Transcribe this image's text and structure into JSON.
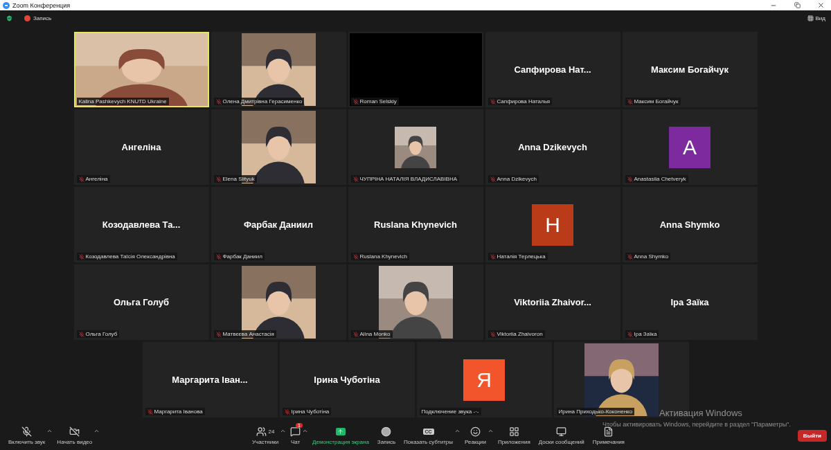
{
  "window": {
    "title": "Zoom Конференция"
  },
  "topbar": {
    "recording": "Запись",
    "view": "Вид"
  },
  "rows": [
    [
      {
        "kind": "camera",
        "label": "Kalina Pashkevych KNUTD Ukraine",
        "muted": false,
        "speaking": true
      },
      {
        "kind": "portrait",
        "label": "Олена Дмитрівна Герасименко",
        "muted": true,
        "speaking": false
      },
      {
        "kind": "blank",
        "label": "Roman Selskiy",
        "muted": true,
        "speaking": false
      },
      {
        "kind": "name",
        "name": "Сапфирова  Нат...",
        "label": "Сапфирова Наталья",
        "muted": true,
        "speaking": false
      },
      {
        "kind": "name",
        "name": "Максим Богайчук",
        "label": "Максим Богайчук",
        "muted": true,
        "speaking": false
      }
    ],
    [
      {
        "kind": "name",
        "name": "Ангеліна",
        "label": "Ангеліна",
        "muted": true,
        "speaking": false
      },
      {
        "kind": "portrait",
        "label": "Elena Slityuk",
        "muted": true,
        "speaking": false
      },
      {
        "label": "ЧУПРІНА НАТАЛІЯ ВЛАДИСЛАВІВНА",
        "muted": true,
        "speaking": false
      },
      {
        "kind": "name",
        "name": "Anna Dzikevych",
        "label": "Anna Dzikevych",
        "muted": true,
        "speaking": false
      },
      {
        "kind": "avatar",
        "letter": "A",
        "color": "#7d2a9e",
        "label": "Anastasiia Chetveryk",
        "muted": true,
        "speaking": false
      }
    ],
    [
      {
        "kind": "name",
        "name": "Козодавлева  Та...",
        "label": "Козодавлева Таїсія Олександрівна",
        "muted": true,
        "speaking": false
      },
      {
        "kind": "name",
        "name": "Фарбак Даниил",
        "label": "Фарбак Даниил",
        "muted": true,
        "speaking": false
      },
      {
        "kind": "name",
        "name": "Ruslana Khynevich",
        "label": "Ruslana Khynevich",
        "muted": true,
        "speaking": false
      },
      {
        "kind": "avatar",
        "letter": "H",
        "color": "#b93b18",
        "label": "Наталія Терлецька",
        "muted": true,
        "speaking": false
      },
      {
        "kind": "name",
        "name": "Anna Shymko",
        "label": "Anna Shymko",
        "muted": true,
        "speaking": false
      }
    ],
    [
      {
        "kind": "name",
        "name": "Ольга Голуб",
        "label": "Ольга Голуб",
        "muted": true,
        "speaking": false
      },
      {
        "kind": "portrait",
        "label": "Матвєєва Анастасія",
        "muted": true,
        "speaking": false
      },
      {
        "kind": "portrait",
        "label": "Alina Monko",
        "muted": true,
        "speaking": false
      },
      {
        "kind": "name",
        "name": "Viktoriia  Zhaivor...",
        "label": "Viktoriia Zhaivoron",
        "muted": true,
        "speaking": false
      },
      {
        "kind": "name",
        "name": "Іра Заїка",
        "label": "Іра Заїка",
        "muted": true,
        "speaking": false
      }
    ],
    [
      {
        "kind": "name",
        "name": "Маргарита Іван...",
        "label": "Маргарита Іванова",
        "muted": true,
        "speaking": false
      },
      {
        "kind": "name",
        "name": "Ірина Чуботіна",
        "label": "Ірина Чуботіна",
        "muted": true,
        "speaking": false
      },
      {
        "kind": "avatar",
        "letter": "Я",
        "color": "#f2552b",
        "label": "Подключение звука -·-",
        "muted": false,
        "speaking": false
      },
      {
        "kind": "portrait",
        "label": "Ирина Приходько-Коконенко",
        "muted": false,
        "speaking": false
      }
    ]
  ],
  "activation": {
    "title": "Активация Windows",
    "text": "Чтобы активировать Windows, перейдите в раздел \"Параметры\"."
  },
  "toolbar": [
    {
      "kind": "mic",
      "label": "Включить звук",
      "caret": true
    },
    {
      "kind": "video",
      "label": "Начать видео",
      "caret": true
    },
    {
      "kind": "participants",
      "label": "Участники",
      "count": "24",
      "caret": true
    },
    {
      "kind": "chat",
      "label": "Чат",
      "badge": "1",
      "caret": true
    },
    {
      "kind": "share",
      "label": "Демонстрация экрана",
      "caret": false
    },
    {
      "kind": "record",
      "label": "Запись",
      "caret": false
    },
    {
      "kind": "captions",
      "label": "Показать субтитры",
      "glyph": "CC",
      "caret": true
    },
    {
      "kind": "reactions",
      "label": "Реакции",
      "caret": true
    },
    {
      "kind": "apps",
      "label": "Приложения",
      "caret": false
    },
    {
      "kind": "whiteboard",
      "label": "Доски сообщений",
      "caret": false
    },
    {
      "kind": "notes",
      "label": "Примечания",
      "caret": false
    }
  ],
  "leave": "Выйти"
}
